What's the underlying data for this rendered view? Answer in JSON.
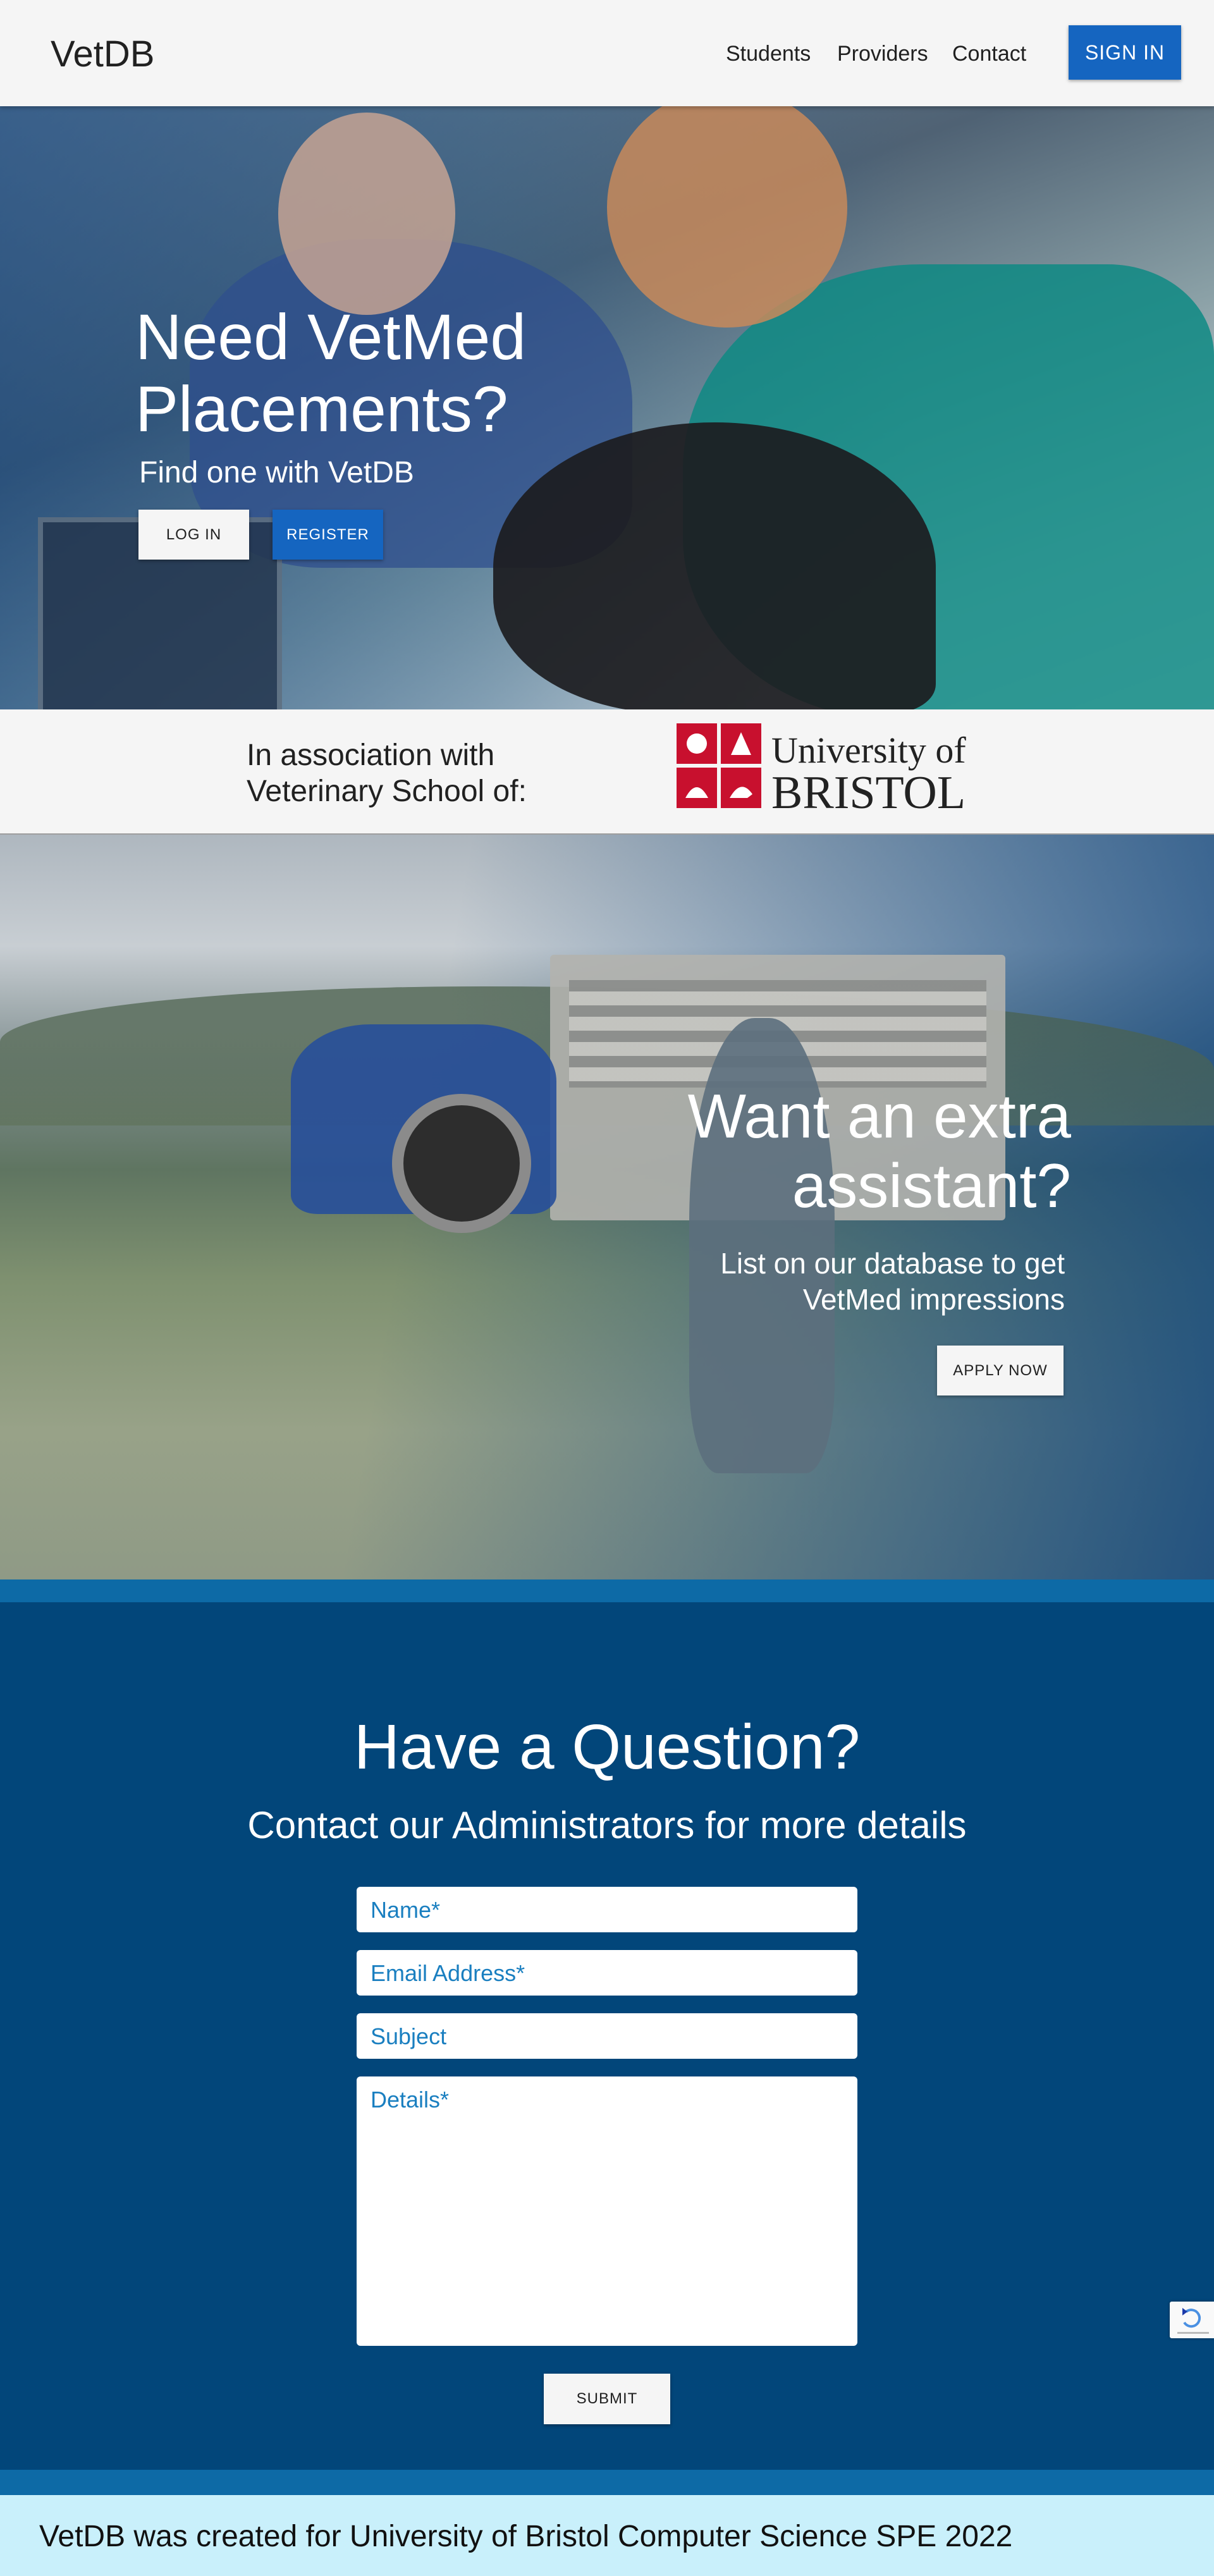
{
  "navbar": {
    "brand": "VetDB",
    "links": [
      "Students",
      "Providers",
      "Contact"
    ],
    "signin_label": "SIGN IN",
    "signin_color": "#1565c0"
  },
  "hero": {
    "title": "Need VetMed Placements?",
    "subtitle": "Find one with VetDB",
    "login_label": "LOG IN",
    "register_label": "REGISTER"
  },
  "association": {
    "text_line1": "In association with",
    "text_line2": "Veterinary School of:",
    "logo_line1": "University of",
    "logo_line2": "BRISTOL",
    "logo_color": "#c8102e"
  },
  "provider": {
    "title": "Want an extra assistant?",
    "subtitle": "List on our database to get VetMed impressions",
    "apply_label": "APPLY NOW"
  },
  "question": {
    "title": "Have a Question?",
    "subtitle": "Contact our Administrators for more details",
    "name_placeholder": "Name*",
    "email_placeholder": "Email Address*",
    "subject_placeholder": "Subject",
    "details_placeholder": "Details*",
    "submit_label": "SUBMIT",
    "background_color": "#02467a"
  },
  "footer": {
    "text": "VetDB was created for University of Bristol Computer Science SPE 2022",
    "background_color": "#c9f0fb"
  }
}
